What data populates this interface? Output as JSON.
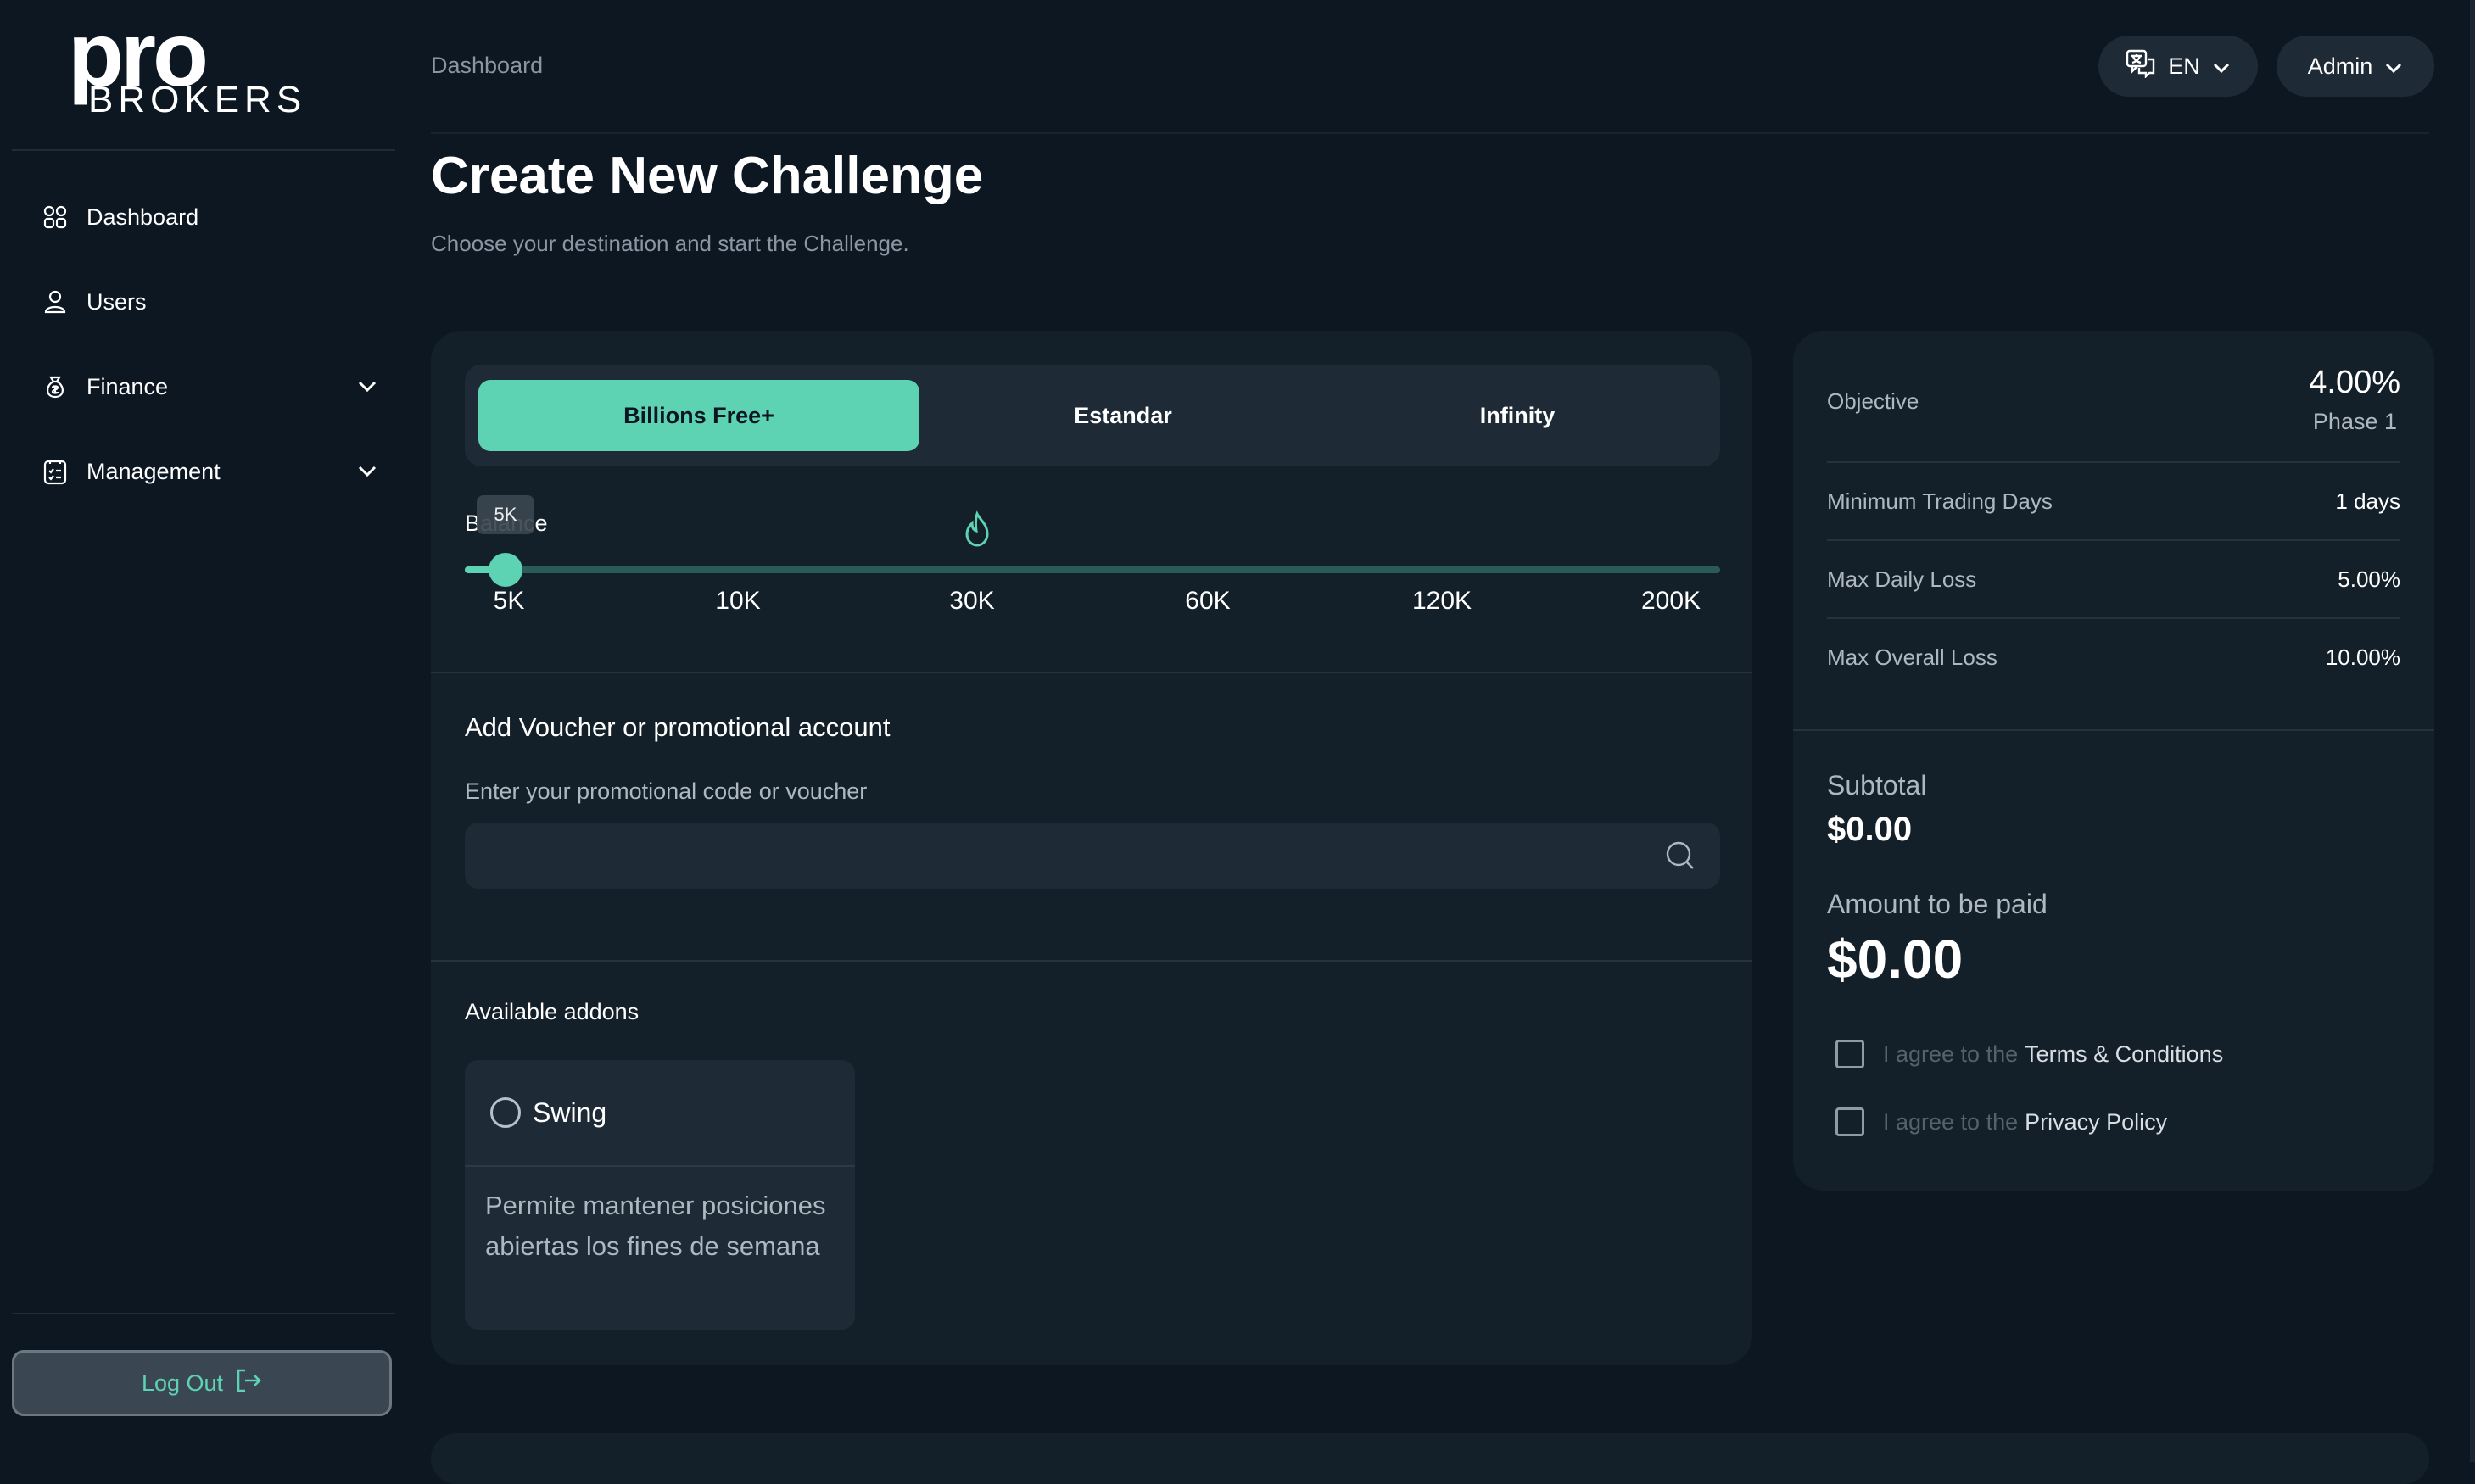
{
  "brand": {
    "logo_main": "pro",
    "logo_sub": "BROKERS"
  },
  "sidebar": {
    "items": [
      {
        "label": "Dashboard",
        "icon": "dashboard-grid-icon"
      },
      {
        "label": "Users",
        "icon": "user-icon"
      },
      {
        "label": "Finance",
        "icon": "money-bag-icon",
        "expandable": true
      },
      {
        "label": "Management",
        "icon": "clipboard-check-icon",
        "expandable": true
      }
    ],
    "logout_label": "Log Out"
  },
  "header": {
    "breadcrumb": "Dashboard",
    "language": "EN",
    "user": "Admin"
  },
  "page": {
    "title": "Create New Challenge",
    "subtitle": "Choose your destination and start the Challenge."
  },
  "challenge": {
    "tabs": [
      {
        "label": "Billions Free+",
        "active": true
      },
      {
        "label": "Estandar",
        "active": false
      },
      {
        "label": "Infinity",
        "active": false
      }
    ],
    "balance_label": "Balance",
    "selected_balance": "5K",
    "balance_options": [
      "5K",
      "10K",
      "30K",
      "60K",
      "120K",
      "200K"
    ]
  },
  "voucher": {
    "title": "Add Voucher or promotional account",
    "label": "Enter your promotional code or voucher",
    "value": "",
    "placeholder": ""
  },
  "addons": {
    "title": "Available addons",
    "items": [
      {
        "name": "Swing",
        "description": "Permite mantener posiciones abiertas los fines de semana",
        "selected": false
      }
    ]
  },
  "summary": {
    "objective_label": "Objective",
    "objective_value": "4.00%",
    "objective_phase": "Phase 1",
    "rows": [
      {
        "label": "Minimum Trading Days",
        "value": "1 days"
      },
      {
        "label": "Max Daily Loss",
        "value": "5.00%"
      },
      {
        "label": "Max Overall Loss",
        "value": "10.00%"
      }
    ],
    "subtotal_label": "Subtotal",
    "subtotal_value": "$0.00",
    "amount_label": "Amount to be paid",
    "amount_value": "$0.00",
    "agreements": [
      {
        "prefix": "I agree to the",
        "link": "Terms & Conditions",
        "checked": false
      },
      {
        "prefix": "I agree to the",
        "link": "Privacy Policy",
        "checked": false
      }
    ]
  },
  "colors": {
    "background": "#0c1722",
    "card": "#142029",
    "accent": "#5ed3b4",
    "muted_text": "#8a97a3"
  }
}
